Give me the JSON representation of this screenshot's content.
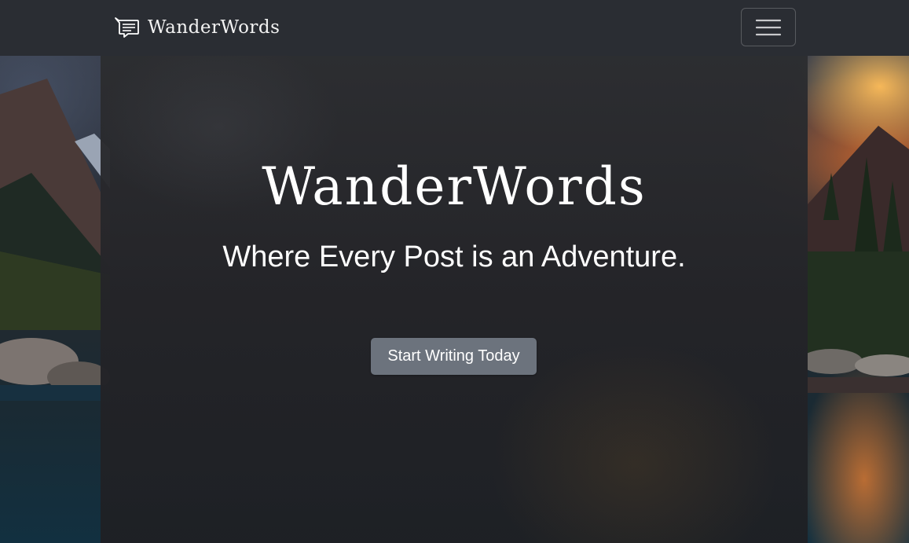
{
  "navbar": {
    "brand_name": "WanderWords",
    "brand_icon": "chat-lines-icon",
    "menu_icon": "hamburger-menu-icon"
  },
  "hero": {
    "title": "WanderWords",
    "subtitle": "Where Every Post is an Adventure.",
    "cta_label": "Start Writing Today"
  },
  "colors": {
    "navbar_bg": "#2a2d33",
    "cta_bg": "#6c737d",
    "text": "#ffffff"
  }
}
